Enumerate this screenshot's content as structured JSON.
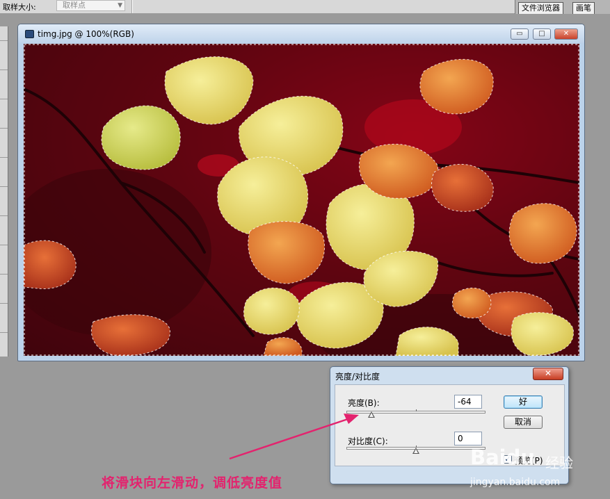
{
  "options_bar": {
    "sample_size_label": "取样大小:",
    "sample_size_value": "取样点",
    "palette_tabs": [
      "文件浏览器",
      "画笔"
    ]
  },
  "document": {
    "title": "timg.jpg @ 100%(RGB)",
    "controls": {
      "minimize": "▭",
      "restore": "□",
      "close": "✕"
    }
  },
  "dialog": {
    "title": "亮度/对比度",
    "close": "✕",
    "brightness": {
      "label": "亮度(B):",
      "value": "-64",
      "slider_fraction": 0.18
    },
    "contrast": {
      "label": "对比度(C):",
      "value": "0",
      "slider_fraction": 0.5
    },
    "ok_label": "好",
    "cancel_label": "取消",
    "preview": {
      "label": "预览(P)",
      "checked": true,
      "mark": "✓"
    }
  },
  "annotation": {
    "caption": "将滑块向左滑动，调低亮度值",
    "accent_color": "#e3236e"
  },
  "watermark": {
    "logo": "Baidu",
    "sub": "经验",
    "url": "jingyan.baidu.com"
  }
}
